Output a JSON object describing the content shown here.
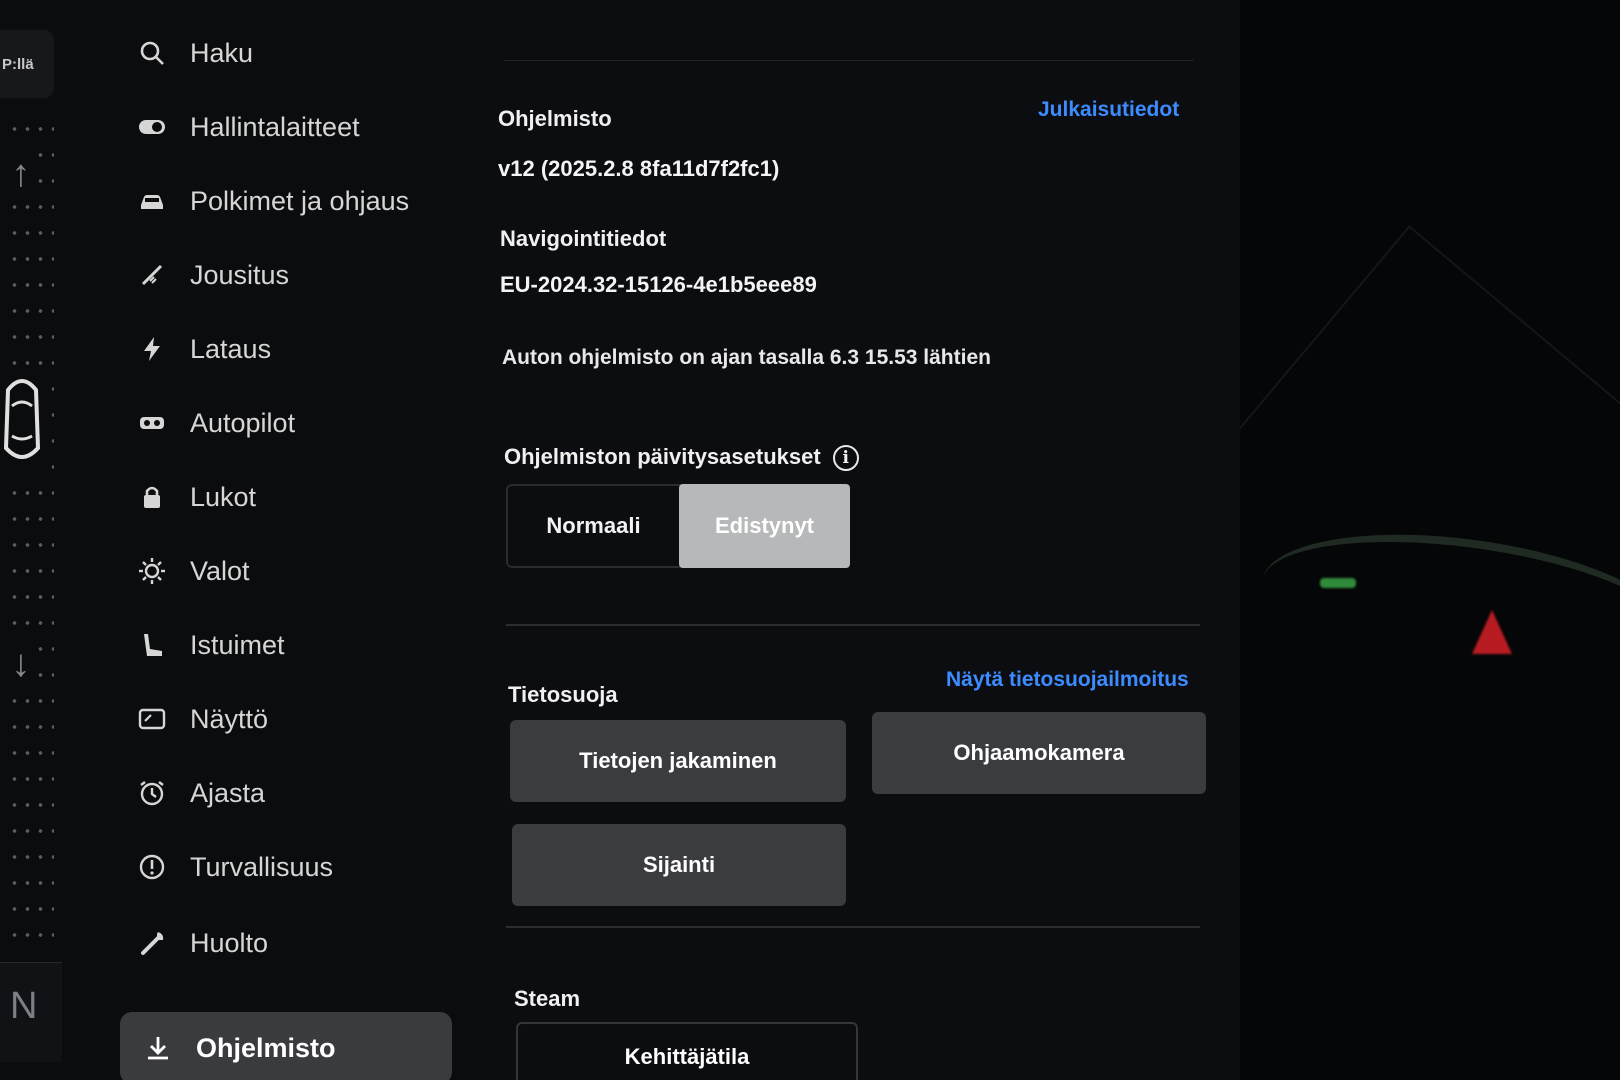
{
  "rail": {
    "gear_top": "P:llä",
    "gear_bottom": "N"
  },
  "sidebar": {
    "items": [
      {
        "label": "Haku",
        "icon": "search-icon"
      },
      {
        "label": "Hallintalaitteet",
        "icon": "toggle-icon"
      },
      {
        "label": "Polkimet ja ohjaus",
        "icon": "car-icon"
      },
      {
        "label": "Jousitus",
        "icon": "suspension-icon"
      },
      {
        "label": "Lataus",
        "icon": "lightning-icon"
      },
      {
        "label": "Autopilot",
        "icon": "steering-wheel-icon"
      },
      {
        "label": "Lukot",
        "icon": "lock-icon"
      },
      {
        "label": "Valot",
        "icon": "sun-icon"
      },
      {
        "label": "Istuimet",
        "icon": "seat-icon"
      },
      {
        "label": "Näyttö",
        "icon": "display-icon"
      },
      {
        "label": "Ajasta",
        "icon": "alarm-clock-icon"
      },
      {
        "label": "Turvallisuus",
        "icon": "alert-circle-icon"
      },
      {
        "label": "Huolto",
        "icon": "wrench-icon"
      },
      {
        "label": "Ohjelmisto",
        "icon": "download-icon",
        "active": true
      }
    ]
  },
  "software": {
    "title": "Ohjelmisto",
    "release_notes_link": "Julkaisutiedot",
    "version": "v12 (2025.2.8 8fa11d7f2fc1)",
    "nav_title": "Navigointitiedot",
    "nav_version": "EU-2024.32-15126-4e1b5eee89",
    "status": "Auton ohjelmisto on ajan tasalla 6.3 15.53 lähtien",
    "update_title": "Ohjelmiston päivitysasetukset",
    "update_options": [
      "Normaali",
      "Edistynyt"
    ],
    "update_selected": "Edistynyt"
  },
  "privacy": {
    "title": "Tietosuoja",
    "notice_link": "Näytä tietosuojailmoitus",
    "buttons": [
      "Tietojen jakaminen",
      "Ohjaamokamera",
      "Sijainti"
    ]
  },
  "steam": {
    "title": "Steam",
    "button": "Kehittäjätila"
  },
  "colors": {
    "link": "#3d8cff",
    "selected_segment": "#b7b8ba",
    "button_bg": "#3a3c40",
    "active_nav_bg": "#3a3b3f"
  }
}
